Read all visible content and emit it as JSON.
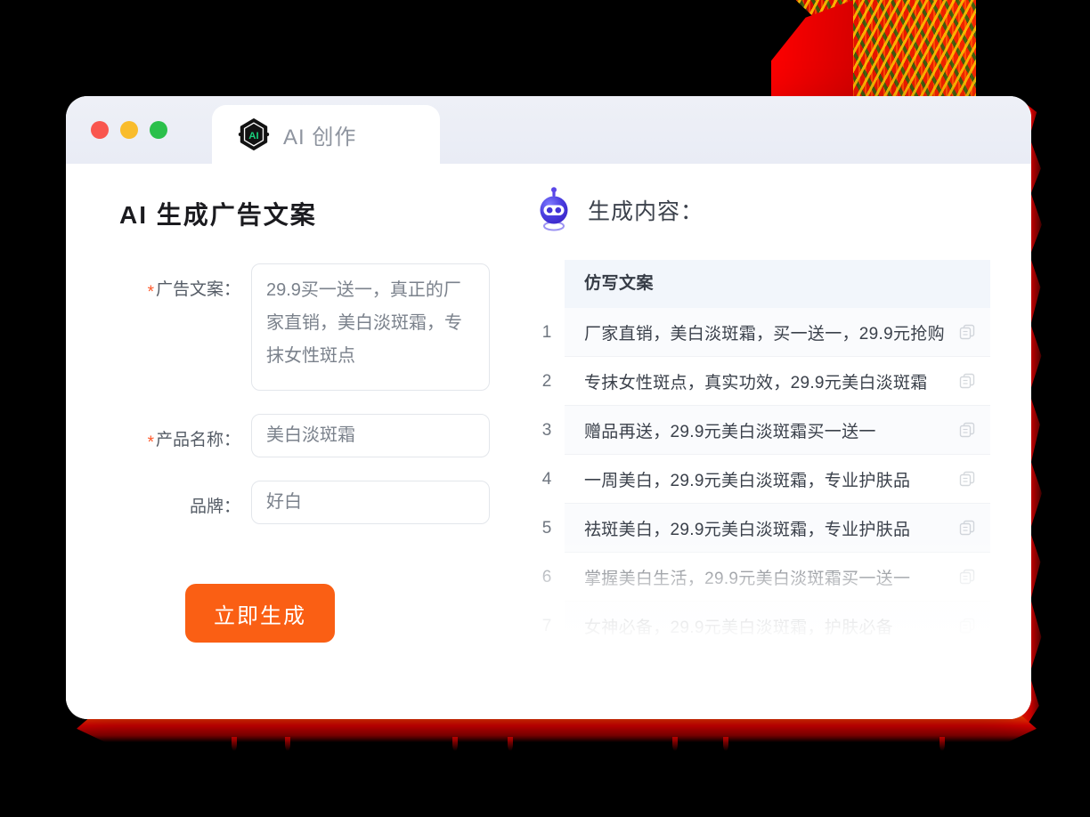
{
  "window": {
    "traffic_lights": [
      {
        "name": "close",
        "color": "#f9564f"
      },
      {
        "name": "minimize",
        "color": "#f9bc2c"
      },
      {
        "name": "maximize",
        "color": "#2bc04b"
      }
    ],
    "tab": {
      "label": "AI 创作",
      "icon": "ai-hexagon-icon",
      "icon_text": "AI",
      "icon_accent": "#19d07c",
      "icon_bg": "#121212"
    }
  },
  "left": {
    "title": "AI 生成广告文案",
    "fields": [
      {
        "label": "广告文案：",
        "required": true,
        "type": "textarea",
        "value": "29.9买一送一，真正的厂家直销，美白淡斑霜，专抹女性斑点"
      },
      {
        "label": "产品名称：",
        "required": true,
        "type": "text",
        "value": "美白淡斑霜"
      },
      {
        "label": "品牌：",
        "required": false,
        "type": "text",
        "value": "好白"
      }
    ],
    "submit_button": {
      "label": "立即生成",
      "color": "#fa5f14"
    }
  },
  "right": {
    "icon": "robot-icon",
    "title": "生成内容：",
    "table": {
      "header": "仿写文案",
      "copy_icon": "copy-icon",
      "rows": [
        {
          "index": "1",
          "text": "厂家直销，美白淡斑霜，买一送一，29.9元抢购"
        },
        {
          "index": "2",
          "text": "专抹女性斑点，真实功效，29.9元美白淡斑霜"
        },
        {
          "index": "3",
          "text": "赠品再送，29.9元美白淡斑霜买一送一"
        },
        {
          "index": "4",
          "text": "一周美白，29.9元美白淡斑霜，专业护肤品"
        },
        {
          "index": "5",
          "text": "祛斑美白，29.9元美白淡斑霜，专业护肤品"
        },
        {
          "index": "6",
          "text": "掌握美白生活，29.9元美白淡斑霜买一送一"
        },
        {
          "index": "7",
          "text": "女神必备，29.9元美白淡斑霜，护肤必备"
        }
      ]
    }
  },
  "decor": {
    "background_color": "#000000",
    "accent_red": "#e81400",
    "accent_orange": "#ff3200"
  }
}
